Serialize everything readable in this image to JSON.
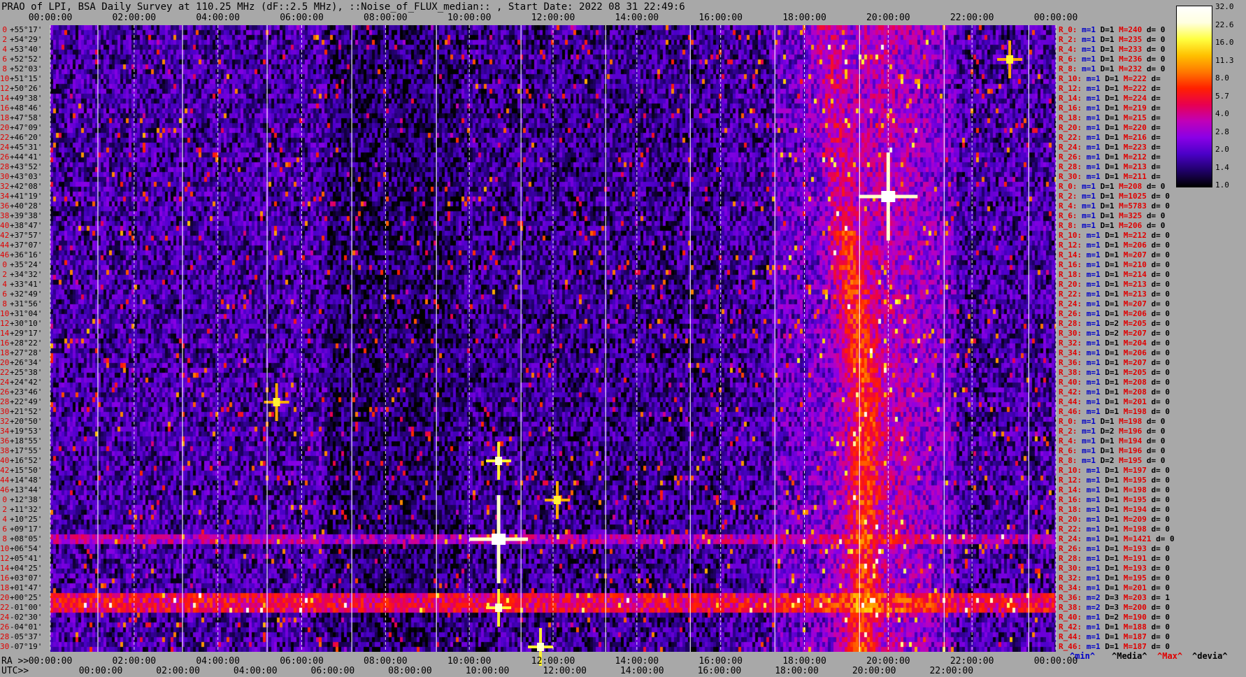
{
  "header": {
    "title": "PRAO of LPI, BSA Daily Survey at 110.25 MHz (dF::2.5 MHz), ::Noise_of_FLUX_median:: , Start Date: 2022 08 31 22:49:6"
  },
  "chart_data": {
    "type": "heatmap",
    "title": "PRAO of LPI, BSA Daily Survey at 110.25 MHz (dF::2.5 MHz), ::Noise_of_FLUX_median:: , Start Date: 2022 08 31 22:49:6",
    "x_axis_top": {
      "ticks": [
        "00:00:00",
        "02:00:00",
        "04:00:00",
        "06:00:00",
        "08:00:00",
        "10:00:00",
        "12:00:00",
        "14:00:00",
        "16:00:00",
        "18:00:00",
        "20:00:00",
        "22:00:00",
        "00:00:00"
      ]
    },
    "x_axis_ra": {
      "prefix": "RA >>",
      "ticks": [
        "00:00:00",
        "02:00:00",
        "04:00:00",
        "06:00:00",
        "08:00:00",
        "10:00:00",
        "12:00:00",
        "14:00:00",
        "16:00:00",
        "18:00:00",
        "20:00:00",
        "22:00:00",
        "00:00:00"
      ]
    },
    "x_axis_utc": {
      "prefix": "UTC>>",
      "ticks": [
        "00:00:00",
        "02:00:00",
        "04:00:00",
        "06:00:00",
        "08:00:00",
        "10:00:00",
        "12:00:00",
        "14:00:00",
        "16:00:00",
        "18:00:00",
        "20:00:00",
        "22:00:00"
      ]
    },
    "y_axis_index": [
      0,
      2,
      4,
      6,
      8,
      10,
      12,
      14,
      16,
      18,
      20,
      22,
      24,
      26,
      28,
      30,
      32,
      34,
      36,
      38,
      40,
      42,
      44,
      46,
      0,
      2,
      4,
      6,
      8,
      10,
      12,
      14,
      16,
      18,
      20,
      22,
      24,
      26,
      28,
      30,
      32,
      34,
      36,
      38,
      40,
      42,
      44,
      46,
      0,
      2,
      4,
      6,
      8,
      10,
      12,
      14,
      16,
      18,
      20,
      22,
      24,
      26,
      28,
      30,
      32,
      34,
      36,
      38,
      40,
      42,
      44,
      46
    ],
    "y_axis_dec": [
      "+55°17'",
      "+54°29'",
      "+53°40'",
      "+52°52'",
      "+52°03'",
      "+51°15'",
      "+50°26'",
      "+49°38'",
      "+48°46'",
      "+47°58'",
      "+47°09'",
      "+46°20'",
      "+45°31'",
      "+44°41'",
      "+43°52'",
      "+43°03'",
      "+42°08'",
      "+41°19'",
      "+40°28'",
      "+39°38'",
      "+38°47'",
      "+37°57'",
      "+37°07'",
      "+36°16'",
      "+35°24'",
      "+34°32'",
      "+33°41'",
      "+32°49'",
      "+31°56'",
      "+31°04'",
      "+30°10'",
      "+29°17'",
      "+28°22'",
      "+27°28'",
      "+26°34'",
      "+25°38'",
      "+24°42'",
      "+23°46'",
      "+22°49'",
      "+21°52'",
      "+20°50'",
      "+19°53'",
      "+18°55'",
      "+17°55'",
      "+16°52'",
      "+15°50'",
      "+14°48'",
      "+13°44'",
      "+12°38'",
      "+11°32'",
      "+10°25'",
      "+09°17'",
      "+08°05'",
      "+06°54'",
      "+05°41'",
      "+04°25'",
      "+03°07'",
      "+01°47'",
      "+00°25'",
      "-01°00'",
      "-02°30'",
      "-04°01'",
      "-05°37'",
      "-07°19'"
    ],
    "colorbar": {
      "ticks": [
        "32.0",
        "22.6",
        "16.0",
        "11.3",
        "8.0",
        "5.7",
        "4.0",
        "2.8",
        "2.0",
        "1.4",
        "1.0"
      ],
      "colors": [
        "#000000",
        "#20006a",
        "#4b00c8",
        "#8a00e6",
        "#c000b8",
        "#e80050",
        "#ff2000",
        "#ff7800",
        "#ffc000",
        "#ffff40",
        "#ffffe0",
        "#ffffff"
      ]
    },
    "row_stats": [
      "R_0: m=1 D=1 M=240 d= 0",
      "R_2: m=1 D=1 M=235 d= 0",
      "R_4: m=1 D=1 M=233 d= 0",
      "R_6: m=1 D=1 M=236 d= 0",
      "R_8: m=1 D=1 M=232 d= 0",
      "R_10: m=1 D=1 M=222 d=",
      "R_12: m=1 D=1 M=222 d=",
      "R_14: m=1 D=1 M=224 d=",
      "R_16: m=1 D=1 M=219 d=",
      "R_18: m=1 D=1 M=215 d=",
      "R_20: m=1 D=1 M=220 d=",
      "R_22: m=1 D=1 M=216 d=",
      "R_24: m=1 D=1 M=223 d=",
      "R_26: m=1 D=1 M=212 d=",
      "R_28: m=1 D=1 M=213 d=",
      "R_30: m=1 D=1 M=211 d=",
      "R_0: m=1 D=1 M=208 d= 0",
      "R_2: m=1 D=1 M=1025 d= 0",
      "R_4: m=1 D=1 M=5783 d= 0",
      "R_6: m=1 D=1 M=325 d= 0",
      "R_8: m=1 D=1 M=206 d= 0",
      "R_10: m=1 D=1 M=212 d= 0",
      "R_12: m=1 D=1 M=206 d= 0",
      "R_14: m=1 D=1 M=207 d= 0",
      "R_16: m=1 D=1 M=210 d= 0",
      "R_18: m=1 D=1 M=214 d= 0",
      "R_20: m=1 D=1 M=213 d= 0",
      "R_22: m=1 D=1 M=213 d= 0",
      "R_24: m=1 D=1 M=207 d= 0",
      "R_26: m=1 D=1 M=206 d= 0",
      "R_28: m=1 D=2 M=205 d= 0",
      "R_30: m=1 D=2 M=207 d= 0",
      "R_32: m=1 D=1 M=204 d= 0",
      "R_34: m=1 D=1 M=206 d= 0",
      "R_36: m=1 D=1 M=207 d= 0",
      "R_38: m=1 D=1 M=205 d= 0",
      "R_40: m=1 D=1 M=208 d= 0",
      "R_42: m=1 D=1 M=208 d= 0",
      "R_44: m=1 D=1 M=201 d= 0",
      "R_46: m=1 D=1 M=198 d= 0",
      "R_0: m=1 D=1 M=198 d= 0",
      "R_2: m=1 D=2 M=196 d= 0",
      "R_4: m=1 D=1 M=194 d= 0",
      "R_6: m=1 D=1 M=196 d= 0",
      "R_8: m=1 D=2 M=195 d= 0",
      "R_10: m=1 D=1 M=197 d= 0",
      "R_12: m=1 D=1 M=195 d= 0",
      "R_14: m=1 D=1 M=198 d= 0",
      "R_16: m=1 D=1 M=195 d= 0",
      "R_18: m=1 D=1 M=194 d= 0",
      "R_20: m=1 D=1 M=209 d= 0",
      "R_22: m=1 D=1 M=198 d= 0",
      "R_24: m=1 D=1 M=1421 d= 0",
      "R_26: m=1 D=1 M=193 d= 0",
      "R_28: m=1 D=1 M=191 d= 0",
      "R_30: m=1 D=1 M=193 d= 0",
      "R_32: m=1 D=1 M=195 d= 0",
      "R_34: m=1 D=1 M=201 d= 0",
      "R_36: m=2 D=3 M=203 d= 1",
      "R_38: m=2 D=3 M=200 d= 0",
      "R_40: m=1 D=2 M=190 d= 0",
      "R_42: m=1 D=1 M=188 d= 0",
      "R_44: m=1 D=1 M=187 d= 0",
      "R_46: m=1 D=1 M=187 d= 0"
    ],
    "legend": {
      "min": "^min^",
      "median": "^Media^",
      "max": "^Max^",
      "deviation": "^devia^"
    },
    "sources": [
      {
        "ra_hours": 20.0,
        "row": 17,
        "intensity": 32.0
      },
      {
        "ra_hours": 10.7,
        "row": 52,
        "intensity": 32.0
      },
      {
        "ra_hours": 10.7,
        "row": 44,
        "intensity": 22.6
      },
      {
        "ra_hours": 10.7,
        "row": 59,
        "intensity": 22.6
      },
      {
        "ra_hours": 12.1,
        "row": 48,
        "intensity": 16.0
      },
      {
        "ra_hours": 5.4,
        "row": 38,
        "intensity": 16.0
      },
      {
        "ra_hours": 11.7,
        "row": 63,
        "intensity": 22.6
      },
      {
        "ra_hours": 22.9,
        "row": 3,
        "intensity": 16.0
      }
    ],
    "bright_bands": [
      {
        "rows": [
          58,
          59
        ],
        "intensity": 5.7
      },
      {
        "rows": [
          52,
          52
        ],
        "intensity": 2.8
      }
    ]
  }
}
